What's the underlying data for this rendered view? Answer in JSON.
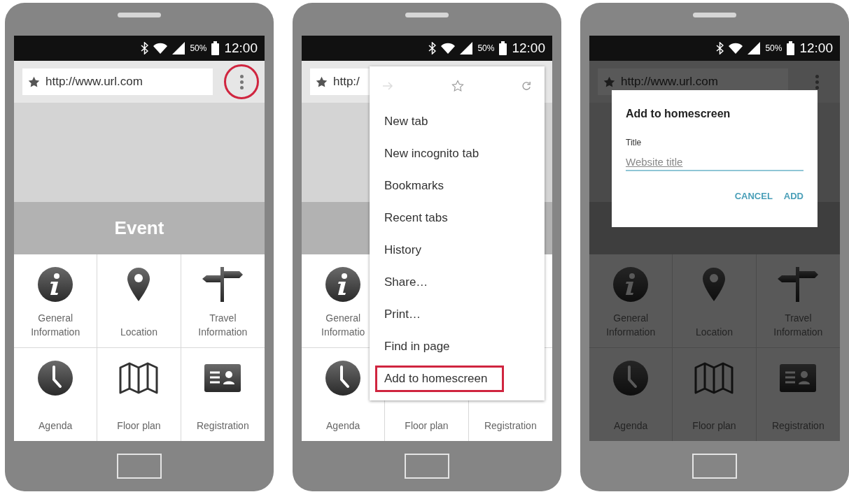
{
  "phones": [
    {
      "kind": "plain",
      "dimmed": false,
      "status": {
        "battery": "50%",
        "time": "12:00"
      },
      "url": "http://www.url.com",
      "menu_button": {
        "highlighted": true
      },
      "event_title": "Event",
      "tiles": [
        {
          "kind": "info",
          "label": [
            "General",
            "Information"
          ]
        },
        {
          "kind": "pin",
          "label": [
            "Location"
          ]
        },
        {
          "kind": "signpost",
          "label": [
            "Travel",
            "Information"
          ]
        },
        {
          "kind": "clock",
          "label": [
            "Agenda"
          ]
        },
        {
          "kind": "map",
          "label": [
            "Floor plan"
          ]
        },
        {
          "kind": "card",
          "label": [
            "Registration"
          ]
        }
      ]
    },
    {
      "kind": "menu",
      "dimmed": false,
      "status": {
        "battery": "50%",
        "time": "12:00"
      },
      "url": "http:/",
      "tiles": [
        {
          "kind": "info",
          "label": [
            "General",
            "Informatio"
          ]
        },
        {
          "kind": "blank"
        },
        {
          "kind": "blank"
        },
        {
          "kind": "clock",
          "label": [
            "Agenda"
          ]
        },
        {
          "kind": "blank",
          "label": [
            "Floor plan"
          ]
        },
        {
          "kind": "blank",
          "label": [
            "Registration"
          ]
        }
      ],
      "menu": {
        "items": [
          {
            "label": "New tab",
            "highlighted": false
          },
          {
            "label": "New incognito tab",
            "highlighted": false
          },
          {
            "label": "Bookmarks",
            "highlighted": false
          },
          {
            "label": "Recent tabs",
            "highlighted": false
          },
          {
            "label": "History",
            "highlighted": false
          },
          {
            "label": "Share…",
            "highlighted": false
          },
          {
            "label": "Print…",
            "highlighted": false
          },
          {
            "label": "Find in page",
            "highlighted": false
          },
          {
            "label": "Add to homescreen",
            "highlighted": true
          }
        ]
      }
    },
    {
      "kind": "dialog",
      "dimmed": true,
      "status": {
        "battery": "50%",
        "time": "12:00"
      },
      "url": "http://www.url.com",
      "menu_button": {
        "highlighted": false
      },
      "tiles": [
        {
          "kind": "info",
          "label": [
            "General",
            "Information"
          ]
        },
        {
          "kind": "pin",
          "label": [
            "Location"
          ]
        },
        {
          "kind": "signpost",
          "label": [
            "Travel",
            "Information"
          ]
        },
        {
          "kind": "clock",
          "label": [
            "Agenda"
          ]
        },
        {
          "kind": "map",
          "label": [
            "Floor plan"
          ]
        },
        {
          "kind": "card",
          "label": [
            "Registration"
          ]
        }
      ],
      "dialog": {
        "title": "Add to homescreen",
        "field_label": "Title",
        "placeholder": "Website title",
        "buttons": [
          "CANCEL",
          "ADD"
        ]
      }
    }
  ]
}
